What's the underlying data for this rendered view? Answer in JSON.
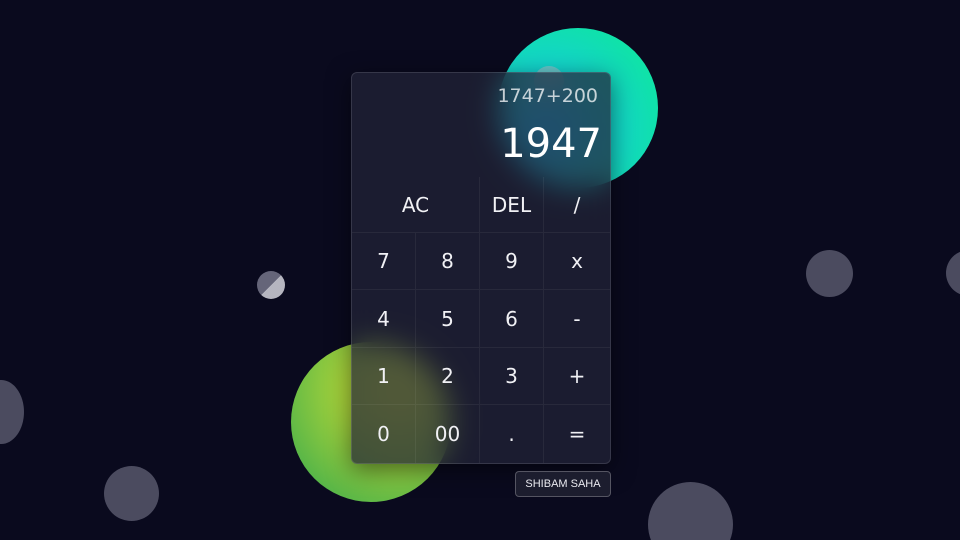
{
  "display": {
    "expression": "1747+200",
    "result": "1947"
  },
  "keys": {
    "ac": "AC",
    "del": "DEL",
    "divide": "/",
    "seven": "7",
    "eight": "8",
    "nine": "9",
    "multiply": "x",
    "four": "4",
    "five": "5",
    "six": "6",
    "minus": "-",
    "one": "1",
    "two": "2",
    "three": "3",
    "plus": "+",
    "zero": "0",
    "double_zero": "00",
    "dot": ".",
    "equals": "="
  },
  "credit": {
    "label": "SHIBAM SAHA"
  },
  "colors": {
    "background": "#0a0a1e",
    "cyan_blob": "#13d4c8",
    "green_blob": "#a8d23a"
  }
}
